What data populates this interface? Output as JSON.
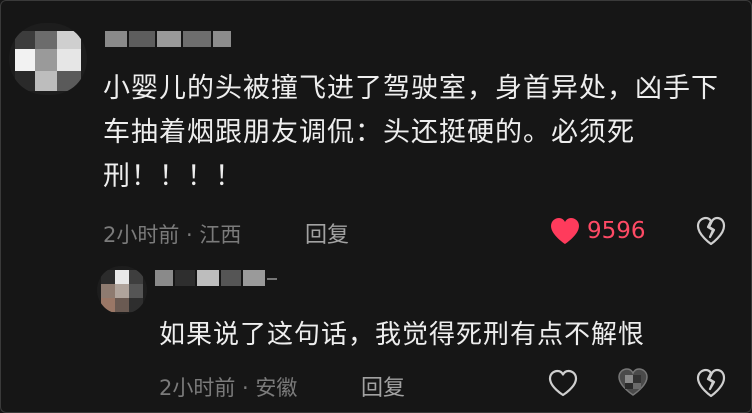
{
  "colors": {
    "background": "#161616",
    "liked_heart": "#ff3b5c",
    "meta_text": "#7b7b7b",
    "body_text": "#eeeeee"
  },
  "comment": {
    "text": "小婴儿的头被撞飞进了驾驶室，身首异处，凶手下车抽着烟跟朋友调侃：头还挺硬的。必须死刑！！！！",
    "time_location": "2小时前 · 江西",
    "reply_label": "回复",
    "like_count": "9596",
    "liked": true
  },
  "reply": {
    "text": "如果说了这句话，我觉得死刑有点不解恨",
    "time_location": "2小时前 · 安徽",
    "reply_label": "回复",
    "liked": false
  },
  "icons": {
    "like": "heart-icon",
    "dislike": "broken-heart-icon",
    "author_like": "author-like-icon"
  }
}
